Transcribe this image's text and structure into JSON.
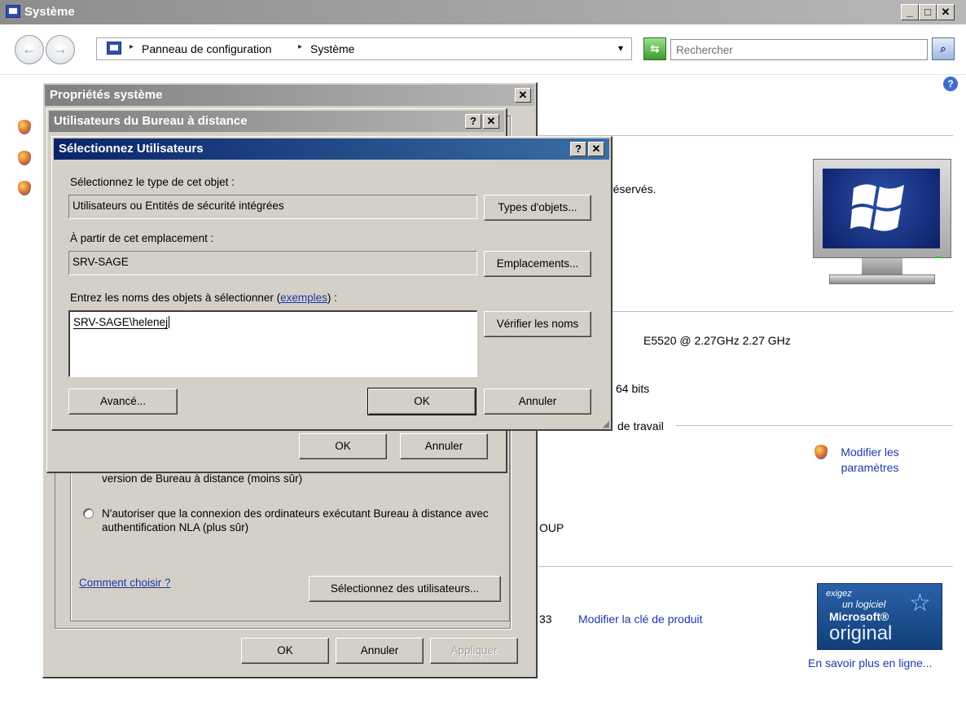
{
  "window": {
    "title": "Système",
    "controls": {
      "minimize": "_",
      "maximize": "□",
      "close": "✕"
    }
  },
  "address_bar": {
    "breadcrumb_sep": "▸",
    "crumbs": [
      "Panneau de configuration",
      "Système"
    ],
    "dropdown_glyph": "▾",
    "search_placeholder": "Rechercher",
    "back_glyph": "←",
    "forward_glyph": "→"
  },
  "help_glyph": "?",
  "background": {
    "copyright_fragment": "réservés.",
    "processor_text": "E5520  @ 2.27GHz   2.27 GHz",
    "system_type_fragment": "64 bits",
    "workgroup_section_fragment": "de travail",
    "modify_settings_link": "Modifier les paramètres",
    "domain_fragment": "OUP",
    "product_id_fragment": "33",
    "change_key_link": "Modifier la clé de produit",
    "learn_more_link": "En savoir plus en ligne...",
    "genuine_badge": {
      "line1": "exigez",
      "line2": "un logiciel",
      "line3": "Microsoft®",
      "line4": "original"
    }
  },
  "dialog_props": {
    "title": "Propriétés système",
    "close": "✕",
    "radio1_text": "version de Bureau à distance (moins sûr)",
    "radio2_text": "N'autoriser que la connexion des ordinateurs exécutant Bureau à distance avec authentification NLA (plus sûr)",
    "how_to_choose_link": "Comment choisir ?",
    "select_users_button": "Sélectionnez des utilisateurs...",
    "ok_button": "OK",
    "cancel_button": "Annuler",
    "apply_button": "Appliquer"
  },
  "dialog_rdu": {
    "title": "Utilisateurs du Bureau à distance",
    "help": "?",
    "close": "✕",
    "ok_button": "OK",
    "cancel_button": "Annuler"
  },
  "dialog_select": {
    "title": "Sélectionnez Utilisateurs",
    "help": "?",
    "close": "✕",
    "object_type_label": "Sélectionnez le type de cet objet :",
    "object_type_value": "Utilisateurs ou Entités de sécurité intégrées",
    "object_types_button": "Types d'objets...",
    "location_label": "À partir de cet emplacement :",
    "location_value": "SRV-SAGE",
    "locations_button": "Emplacements...",
    "names_label_prefix": "Entrez les noms des objets à sélectionner (",
    "examples_link": "exemples",
    "names_label_suffix": ") :",
    "names_value": "SRV-SAGE\\helenej",
    "check_names_button": "Vérifier les noms",
    "advanced_button": "Avancé...",
    "ok_button": "OK",
    "cancel_button": "Annuler"
  }
}
